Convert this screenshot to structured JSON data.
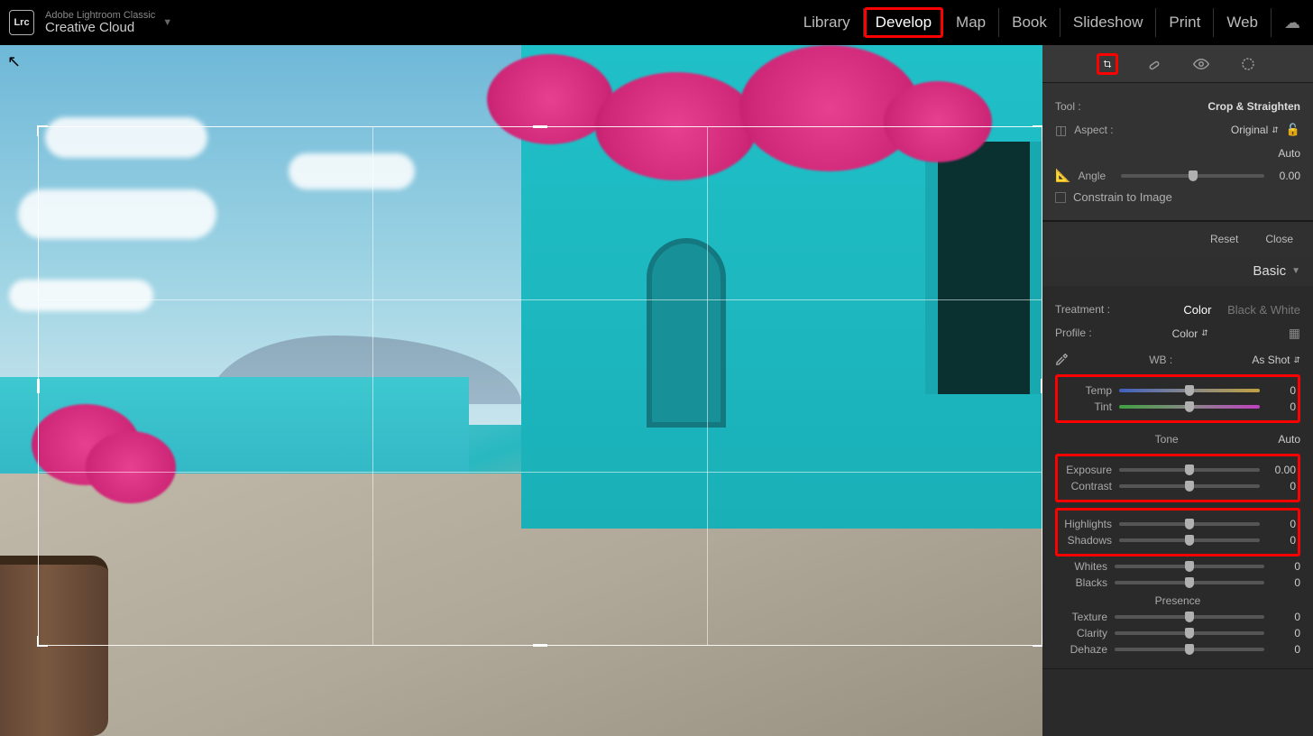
{
  "app": {
    "logo": "Lrc",
    "title_small": "Adobe Lightroom Classic",
    "title_big": "Creative Cloud"
  },
  "nav": {
    "items": [
      "Library",
      "Develop",
      "Map",
      "Book",
      "Slideshow",
      "Print",
      "Web"
    ],
    "active": "Develop"
  },
  "tool_panel": {
    "tool_label": "Tool :",
    "tool_value": "Crop & Straighten",
    "aspect_label": "Aspect :",
    "aspect_value": "Original",
    "angle_label": "Angle",
    "angle_auto": "Auto",
    "angle_value": "0.00",
    "constrain_label": "Constrain to Image",
    "reset": "Reset",
    "close": "Close"
  },
  "basic": {
    "header": "Basic",
    "treatment_label": "Treatment :",
    "treatment_color": "Color",
    "treatment_bw": "Black & White",
    "profile_label": "Profile :",
    "profile_value": "Color",
    "wb_label": "WB :",
    "wb_value": "As Shot",
    "temp_label": "Temp",
    "temp_value": "0",
    "tint_label": "Tint",
    "tint_value": "0",
    "tone_label": "Tone",
    "tone_auto": "Auto",
    "exposure_label": "Exposure",
    "exposure_value": "0.00",
    "contrast_label": "Contrast",
    "contrast_value": "0",
    "highlights_label": "Highlights",
    "highlights_value": "0",
    "shadows_label": "Shadows",
    "shadows_value": "0",
    "whites_label": "Whites",
    "whites_value": "0",
    "blacks_label": "Blacks",
    "blacks_value": "0",
    "presence_label": "Presence",
    "texture_label": "Texture",
    "texture_value": "0",
    "clarity_label": "Clarity",
    "clarity_value": "0",
    "dehaze_label": "Dehaze",
    "dehaze_value": "0"
  }
}
